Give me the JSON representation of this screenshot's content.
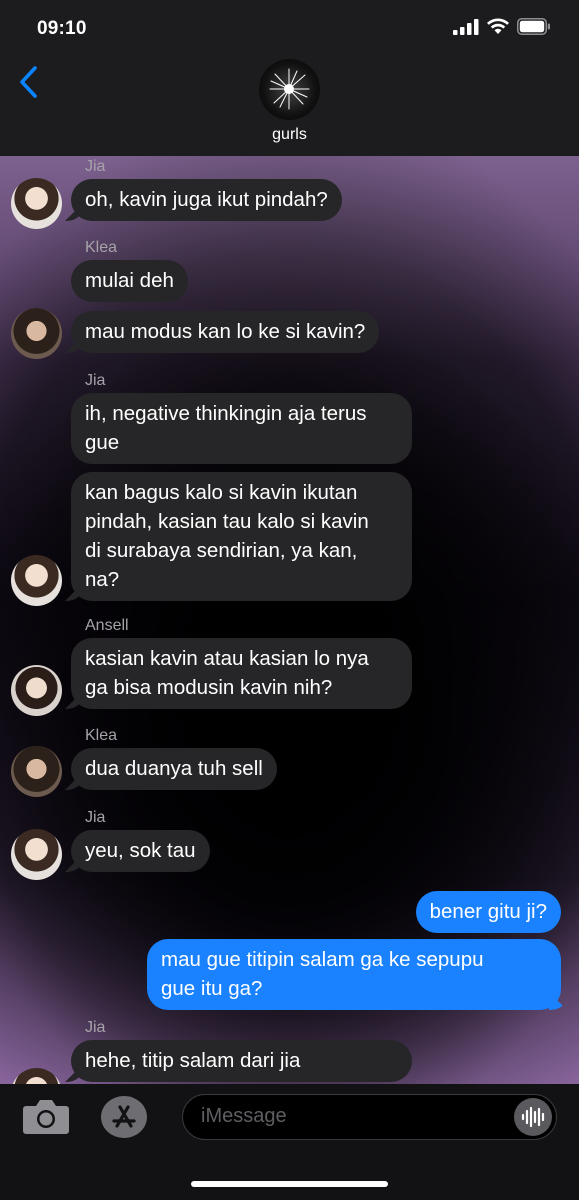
{
  "status": {
    "time": "09:10"
  },
  "header": {
    "group_name": "gurls",
    "back_icon": "chevron-left-icon",
    "avatar_icon": "sparkler-icon"
  },
  "messages": [
    {
      "sender": "Jia",
      "text": "oh, kavin juga ikut pindah?",
      "direction": "in"
    },
    {
      "sender": "Klea",
      "text": "mulai deh",
      "direction": "in"
    },
    {
      "sender": "Klea",
      "text": "mau modus kan lo ke si kavin?",
      "direction": "in"
    },
    {
      "sender": "Jia",
      "text": "ih, negative thinkingin aja terus\ngue",
      "direction": "in"
    },
    {
      "sender": "Jia",
      "text": "kan bagus kalo si kavin ikutan\npindah, kasian tau kalo si kavin\ndi surabaya sendirian, ya kan,\nna?",
      "direction": "in"
    },
    {
      "sender": "Ansell",
      "text": "kasian kavin atau kasian lo nya\nga bisa modusin kavin nih?",
      "direction": "in"
    },
    {
      "sender": "Klea",
      "text": "dua duanya tuh sell",
      "direction": "in"
    },
    {
      "sender": "Jia",
      "text": "yeu, sok tau",
      "direction": "in"
    },
    {
      "sender": "",
      "text": "bener gitu ji?",
      "direction": "out"
    },
    {
      "sender": "",
      "text": "mau gue titipin salam ga ke sepupu\ngue itu ga?",
      "direction": "out"
    },
    {
      "sender": "Jia",
      "text": "hehe, titip salam dari jia",
      "direction": "in"
    }
  ],
  "input": {
    "placeholder": "iMessage"
  },
  "colors": {
    "incoming_bubble": "#262628",
    "outgoing_bubble": "#1a82ff",
    "accent": "#0a84ff"
  }
}
